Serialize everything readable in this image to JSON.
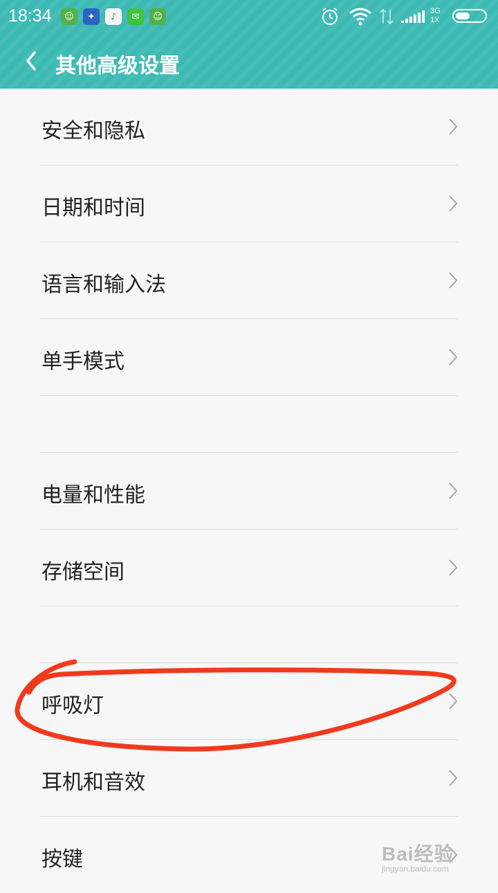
{
  "status": {
    "time": "18:34",
    "network_top": "3G",
    "network_bottom": "1X"
  },
  "header": {
    "title": "其他高级设置"
  },
  "items": [
    {
      "label": "安全和隐私"
    },
    {
      "label": "日期和时间"
    },
    {
      "label": "语言和输入法"
    },
    {
      "label": "单手模式"
    },
    {
      "label": "电量和性能"
    },
    {
      "label": "存储空间"
    },
    {
      "label": "呼吸灯"
    },
    {
      "label": "耳机和音效"
    },
    {
      "label": "按键"
    }
  ],
  "watermark": {
    "brand": "Bai经验",
    "url": "jingyan.baidu.com"
  },
  "colors": {
    "header": "#3dbab4",
    "annotation": "#f03a1e"
  }
}
